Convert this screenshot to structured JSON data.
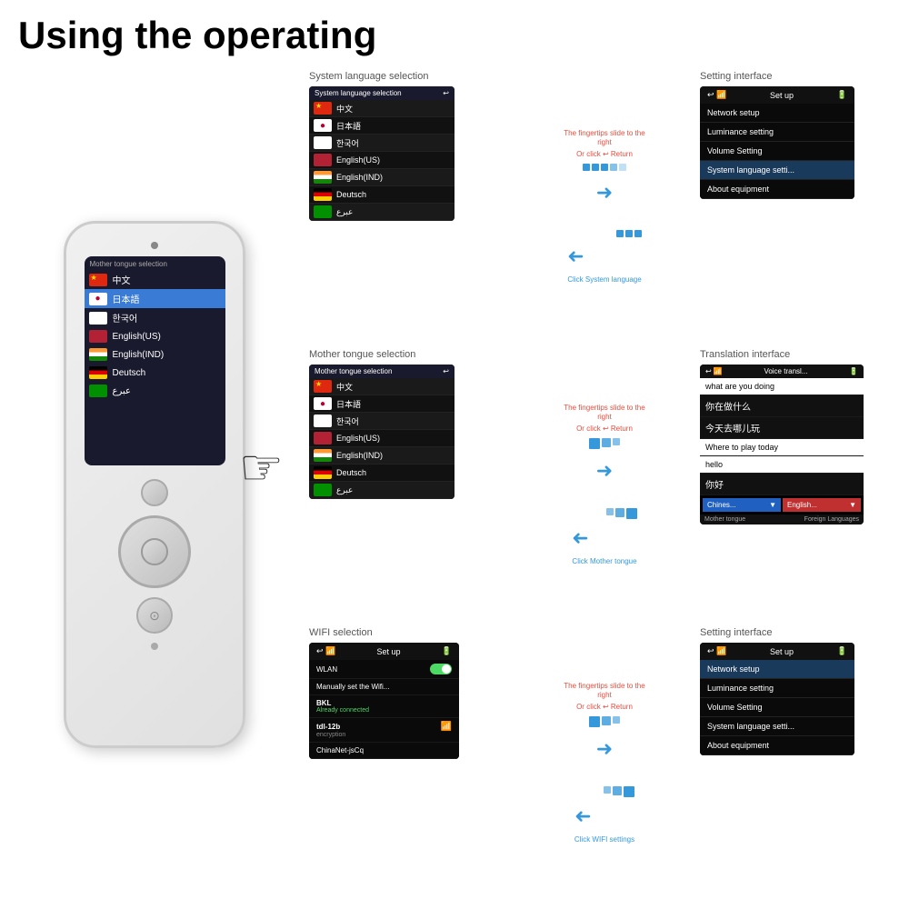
{
  "title": "Using the operating",
  "device": {
    "screen_label": "Mother tongue selection",
    "languages": [
      {
        "name": "中文",
        "flag": "cn"
      },
      {
        "name": "日本語",
        "flag": "jp"
      },
      {
        "name": "한국어",
        "flag": "kr"
      },
      {
        "name": "English(US)",
        "flag": "us"
      },
      {
        "name": "English(IND)",
        "flag": "in"
      },
      {
        "name": "Deutsch",
        "flag": "de"
      },
      {
        "name": "عبرع",
        "flag": "ar"
      }
    ]
  },
  "section1": {
    "label": "System language selection",
    "annotation_right": "The fingertips slide to the right",
    "or_click": "Or click",
    "return": "Return",
    "annotation_left": "Click System language",
    "screen_header": "System language selection",
    "languages": [
      "中文",
      "日本語",
      "한국어",
      "English(US)",
      "English(IND)",
      "Deutsch",
      "عبرع"
    ]
  },
  "section2": {
    "label": "Mother tongue selection",
    "annotation_right": "The fingertips slide to the right",
    "or_click": "Or click",
    "return": "Return",
    "annotation_left": "Click Mother tongue",
    "screen_header": "Mother tongue selection",
    "languages": [
      "中文",
      "日本語",
      "한국어",
      "English(US)",
      "English(IND)",
      "Deutsch",
      "عبرع"
    ]
  },
  "section3": {
    "label": "WIFI selection",
    "annotation_right": "The fingertips slide to the right",
    "or_click": "Or click",
    "return": "Return",
    "annotation_left": "Click WIFI settings",
    "screen_header": "Set up",
    "wlan": "WLAN",
    "manually": "Manually set the Wifi...",
    "network1": "BKL",
    "network1_status": "Already connected",
    "network2": "tdl-12b",
    "network2_status": "encryption",
    "network3": "ChinaNet-jsCq"
  },
  "setting1": {
    "label": "Setting interface",
    "header": "Set up",
    "items": [
      "Network setup",
      "Luminance setting",
      "Volume Setting",
      "System language setti...",
      "About equipment"
    ]
  },
  "setting2": {
    "label": "Translation interface",
    "header": "Voice transl...",
    "items": [
      {
        "text": "what are you doing",
        "type": "english"
      },
      {
        "text": "你在做什么",
        "type": "chinese"
      },
      {
        "text": "今天去哪儿玩",
        "type": "chinese"
      },
      {
        "text": "Where to play today",
        "type": "english"
      },
      {
        "text": "hello",
        "type": "english"
      },
      {
        "text": "你好",
        "type": "chinese"
      }
    ],
    "mother_tongue": "Chines...",
    "foreign_lang": "English...",
    "mother_label": "Mother tongue",
    "foreign_label": "Foreign Languages"
  },
  "setting3": {
    "label": "Setting interface",
    "header": "Set up",
    "items": [
      "Network setup",
      "Luminance setting",
      "Volume Setting",
      "System language setti...",
      "About equipment"
    ]
  }
}
